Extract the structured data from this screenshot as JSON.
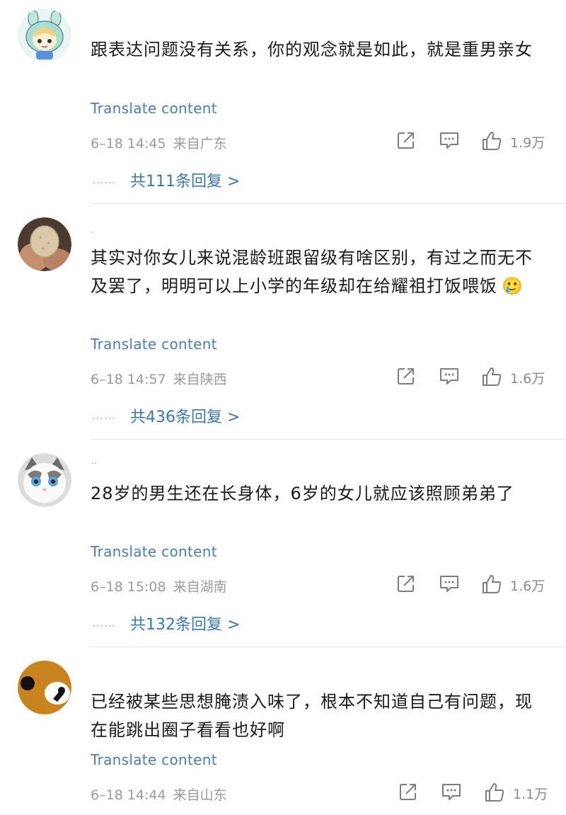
{
  "comments": [
    {
      "text": "跟表达问题没有关系，你的观念就是如此，就是重男亲女",
      "translate": "Translate content",
      "date": "6–18 14:45",
      "location": "来自广东",
      "likes": "1.9万",
      "replies": "共111条回复 >",
      "reply_dots": "……",
      "avatar_icon": "bunny-girl-avatar"
    },
    {
      "marker": ".",
      "text": "其实对你女儿来说混龄班跟留级有啥区别，有过之而无不及罢了，明明可以上小学的年级却在给耀祖打饭喂饭",
      "emoji": "🥲",
      "translate": "Translate content",
      "date": "6–18 14:57",
      "location": "来自陕西",
      "likes": "1.6万",
      "replies": "共436条回复 >",
      "reply_dots": "……",
      "avatar_icon": "cookie-in-hand-avatar"
    },
    {
      "marker": "..",
      "text": "28岁的男生还在长身体，6岁的女儿就应该照顾弟弟了",
      "translate": "Translate content",
      "date": "6–18 15:08",
      "location": "来自湖南",
      "likes": "1.6万",
      "replies": "共132条回复 >",
      "reply_dots": "……",
      "avatar_icon": "white-cat-avatar"
    },
    {
      "text": "已经被某些思想腌渍入味了，根本不知道自己有问题，现在能跳出圈子看看也好啊",
      "translate": "Translate content",
      "date": "6–18 14:44",
      "location": "来自山东",
      "likes": "1.1万",
      "avatar_icon": "orange-cartoon-avatar"
    }
  ],
  "colors": {
    "link": "#3c78b4",
    "translate": "#4a7fb0",
    "meta": "#9b9b9b",
    "divider": "#e6e6e6",
    "icon": "#7d7d7d"
  }
}
